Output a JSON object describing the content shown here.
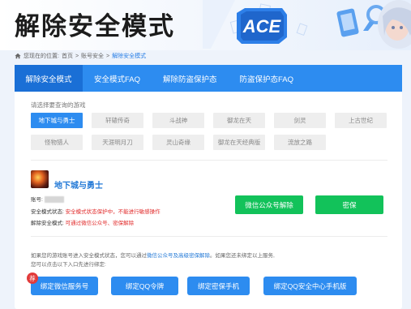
{
  "header": {
    "title": "解除安全模式"
  },
  "breadcrumb": {
    "prefix": "您现在的位置:",
    "home": "首页",
    "sep1": ">",
    "level2": "账号安全",
    "sep2": ">",
    "current": "解除安全模式"
  },
  "tabs": [
    {
      "label": "解除安全模式"
    },
    {
      "label": "安全模式FAQ"
    },
    {
      "label": "解除防盗保护态"
    },
    {
      "label": "防盗保护态FAQ"
    }
  ],
  "games": {
    "prompt": "请选择要查询的游戏",
    "selected": "地下城与勇士",
    "items": [
      {
        "label": "地下城与勇士"
      },
      {
        "label": "轩辕传奇"
      },
      {
        "label": "斗战神"
      },
      {
        "label": "御龙在天"
      },
      {
        "label": "剑灵"
      },
      {
        "label": "上古世纪"
      },
      {
        "label": "怪物猎人"
      },
      {
        "label": "天涯明月刀"
      },
      {
        "label": "灵山奇缘"
      },
      {
        "label": "御龙在天经典版"
      },
      {
        "label": "流放之路"
      }
    ]
  },
  "account": {
    "game_name": "地下城与勇士",
    "account_label": "账号:",
    "status_label": "安全模式状态:",
    "status_value": "安全模式状态保护中，不能进行敏感操作",
    "unlock_label": "解除安全模式:",
    "unlock_value": "可通过微信公众号、密保解除",
    "wechat_button": "微信公众号解除",
    "mibao_button": "密保"
  },
  "note": {
    "line1_a": "如果您的游戏账号进入安全模式状态，您可以通过",
    "line1_link": "微信公众号及高级密保解除",
    "line1_b": "。如果您还未绑定以上服务,",
    "line2": "您可以点击以下入口先进行绑定:"
  },
  "bind_buttons": {
    "badge": "荐",
    "wechat": "绑定微信服务号",
    "qq_token": "绑定QQ令牌",
    "mibao_phone": "绑定密保手机",
    "qq_mobile": "绑定QQ安全中心手机版"
  },
  "colors": {
    "accent": "#2d8cf0",
    "accent_dark": "#1a6fd6",
    "green": "#12c25a",
    "red": "#e12b2b",
    "link": "#2178d6"
  }
}
